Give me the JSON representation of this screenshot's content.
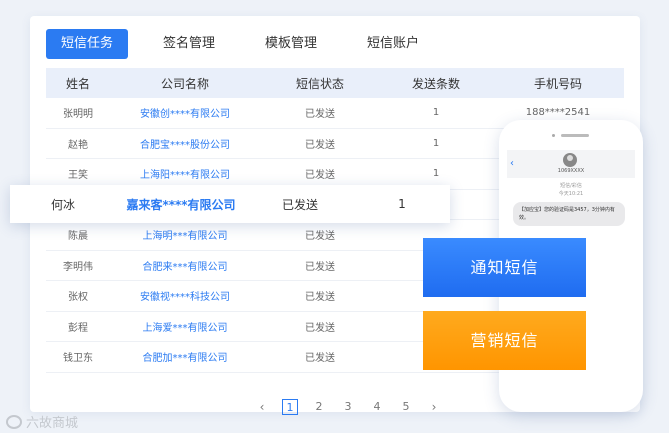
{
  "tabs": [
    {
      "label": "短信任务",
      "active": true
    },
    {
      "label": "签名管理",
      "active": false
    },
    {
      "label": "模板管理",
      "active": false
    },
    {
      "label": "短信账户",
      "active": false
    }
  ],
  "table": {
    "headers": [
      "姓名",
      "公司名称",
      "短信状态",
      "发送条数",
      "手机号码"
    ],
    "rows": [
      {
        "name": "张明明",
        "company": "安徽创****有限公司",
        "status": "已发送",
        "count": "1",
        "phone": "188****2541"
      },
      {
        "name": "赵艳",
        "company": "合肥宝****股份公司",
        "status": "已发送",
        "count": "1",
        "phone": ""
      },
      {
        "name": "王笑",
        "company": "上海阳****有限公司",
        "status": "已发送",
        "count": "1",
        "phone": ""
      },
      {
        "name": "",
        "company": "",
        "status": "",
        "count": "",
        "phone": ""
      },
      {
        "name": "陈晨",
        "company": "上海明***有限公司",
        "status": "已发送",
        "count": "",
        "phone": ""
      },
      {
        "name": "李明伟",
        "company": "合肥来***有限公司",
        "status": "已发送",
        "count": "",
        "phone": ""
      },
      {
        "name": "张权",
        "company": "安徽视****科技公司",
        "status": "已发送",
        "count": "",
        "phone": ""
      },
      {
        "name": "彭程",
        "company": "上海爱***有限公司",
        "status": "已发送",
        "count": "",
        "phone": ""
      },
      {
        "name": "钱卫东",
        "company": "合肥加***有限公司",
        "status": "已发送",
        "count": "",
        "phone": ""
      }
    ]
  },
  "highlight_row": {
    "name": "何冰",
    "company": "嘉来客****有限公司",
    "status": "已发送",
    "count": "1"
  },
  "pagination": {
    "prev": "‹",
    "next": "›",
    "pages": [
      "1",
      "2",
      "3",
      "4",
      "5"
    ],
    "current": "1"
  },
  "phone": {
    "sender": "1069XXXX",
    "meta1": "短信/彩信",
    "meta2": "今天10:21",
    "message": "【加应宝】您的验证码是3457，3分钟内有效。"
  },
  "buttons": {
    "notify": "通知短信",
    "marketing": "营销短信"
  },
  "watermark": {
    "text": "六故商城"
  },
  "colors": {
    "accent": "#2b7bf2",
    "orange": "#ff9500"
  }
}
